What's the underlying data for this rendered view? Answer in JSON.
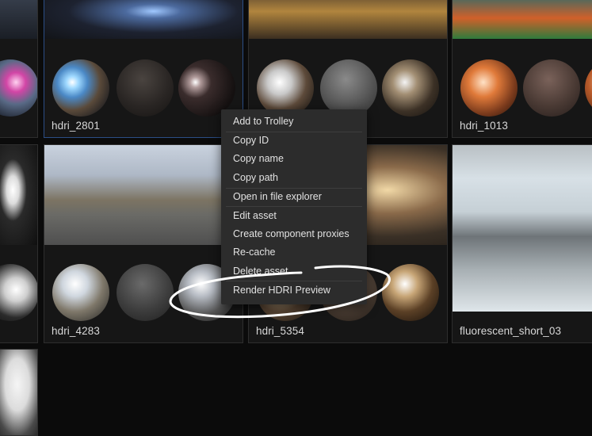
{
  "assets": [
    {
      "label": ""
    },
    {
      "label": "hdri_2801"
    },
    {
      "label": ""
    },
    {
      "label": "hdri_1013"
    },
    {
      "label": ""
    },
    {
      "label": "hdri_4283"
    },
    {
      "label": "hdri_5354"
    },
    {
      "label": "fluorescent_short_03"
    },
    {
      "label": ""
    }
  ],
  "context_menu": {
    "items": [
      "Add to Trolley",
      "Copy ID",
      "Copy name",
      "Copy path",
      "Open in file explorer",
      "Edit asset",
      "Create component proxies",
      "Re-cache",
      "Delete asset",
      "Render HDRI Preview"
    ]
  },
  "annotation": {
    "shape": "hand-drawn ellipse",
    "target": "Render HDRI Preview",
    "color": "#ffffff"
  }
}
